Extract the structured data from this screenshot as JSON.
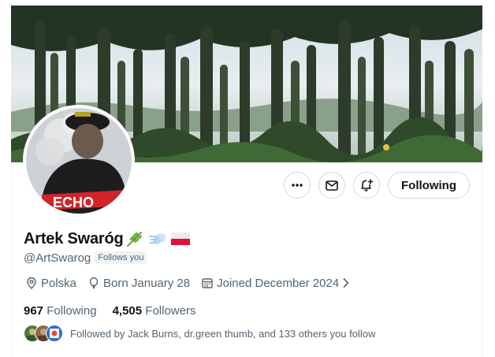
{
  "profile": {
    "display_name": "Artek Swaróg",
    "handle": "@ArtSwarog",
    "follows_you_badge": "Follows you",
    "name_emojis": [
      "herb-emoji",
      "dash-emoji",
      "poland-flag-emoji"
    ]
  },
  "actions": {
    "following_label": "Following"
  },
  "meta": {
    "location": "Polska",
    "birthday": "Born January 28",
    "joined": "Joined December 2024"
  },
  "stats": {
    "following_count": "967",
    "following_label": "Following",
    "followers_count": "4,505",
    "followers_label": "Followers"
  },
  "followed_by": {
    "text": "Followed by Jack Burns, dr.green thumb, and 133 others you follow"
  },
  "colors": {
    "text_primary": "#0f1419",
    "text_secondary": "#536471",
    "border": "#cfd9de"
  }
}
